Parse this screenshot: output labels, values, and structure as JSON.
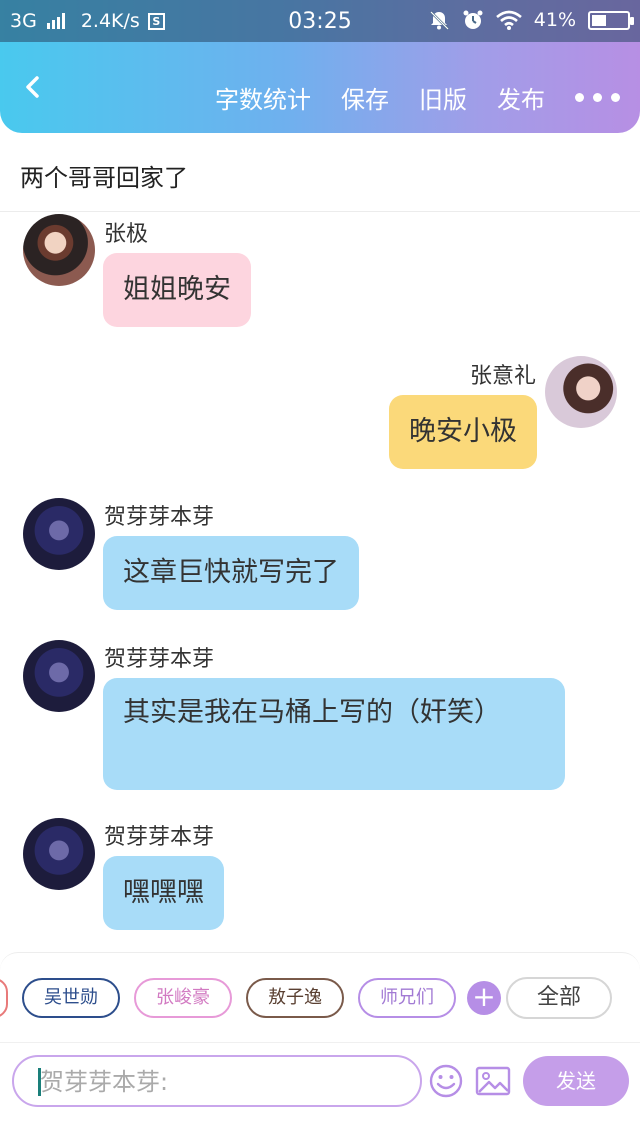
{
  "status_bar": {
    "network": "3G",
    "speed": "2.4K/s",
    "s_icon": "S",
    "time": "03:25",
    "battery": "41%",
    "battery_level": 0.41
  },
  "header": {
    "back_icon": "chevron-left-icon",
    "actions": [
      "字数统计",
      "保存",
      "旧版",
      "发布"
    ],
    "more_icon": "more-dots-icon"
  },
  "title": "两个哥哥回家了",
  "messages": [
    {
      "sender": "张极",
      "text": "姐姐晚安",
      "side": "left",
      "color": "#fdd5df"
    },
    {
      "sender": "张意礼",
      "text": "晚安小极",
      "side": "right",
      "color": "#fbd97a"
    },
    {
      "sender": "贺芽芽本芽",
      "text": "这章巨快就写完了",
      "side": "left",
      "color": "#a8dcf8"
    },
    {
      "sender": "贺芽芽本芽",
      "text": "其实是我在马桶上写的（奸笑）",
      "side": "left",
      "color": "#a8dcf8"
    },
    {
      "sender": "贺芽芽本芽",
      "text": "嘿嘿嘿",
      "side": "left",
      "color": "#a8dcf8"
    }
  ],
  "tags": [
    {
      "label": "吴世勋",
      "color": "#2d4e8c"
    },
    {
      "label": "张峻豪",
      "color": "#e79ad8"
    },
    {
      "label": "敖子逸",
      "color": "#7a5a4a"
    },
    {
      "label": "师兄们",
      "color": "#b68ee6"
    }
  ],
  "all_label": "全部",
  "input": {
    "placeholder": "贺芽芽本芽:"
  },
  "send_label": "发送",
  "colors": {
    "header_gradient_start": "#49c9ee",
    "header_gradient_end": "#b78fe4",
    "accent_purple": "#c59ee9"
  }
}
